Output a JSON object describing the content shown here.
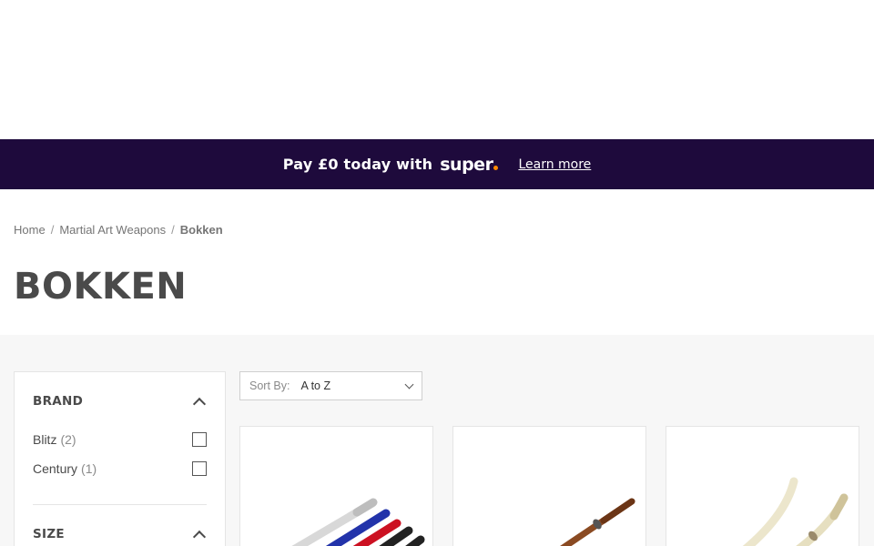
{
  "promo": {
    "text": "Pay £0 today with",
    "brand": "super",
    "link": "Learn more"
  },
  "breadcrumb": {
    "home": "Home",
    "separator": "/",
    "category": "Martial Art Weapons",
    "current": "Bokken"
  },
  "page": {
    "title": "BOKKEN"
  },
  "filters": {
    "brand": {
      "title": "BRAND",
      "options": [
        {
          "label": "Blitz",
          "count": "(2)"
        },
        {
          "label": "Century",
          "count": "(1)"
        }
      ]
    },
    "size": {
      "title": "SIZE"
    }
  },
  "sort": {
    "label": "Sort By:",
    "value": "A to Z"
  },
  "products": [
    {
      "image": "colored-bokken-set-image"
    },
    {
      "image": "brown-bokken-image"
    },
    {
      "image": "white-bokken-pair-image"
    }
  ],
  "colors": {
    "promo_bg": "#1e0a3c",
    "super_dot": "#ff8a00",
    "content_bg": "#f7f7f7",
    "title": "#4a4a4a"
  }
}
